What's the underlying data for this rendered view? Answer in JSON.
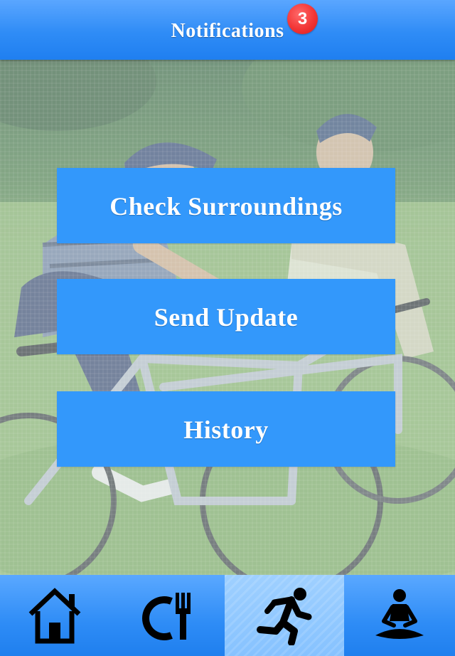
{
  "header": {
    "title": "Notifications",
    "badge_count": "3"
  },
  "menu": {
    "check_surroundings": "Check Surroundings",
    "send_update": "Send Update",
    "history": "History"
  },
  "tabbar": {
    "tabs": [
      {
        "icon": "home-icon",
        "active": false
      },
      {
        "icon": "restaurant-icon",
        "active": false
      },
      {
        "icon": "running-icon",
        "active": true
      },
      {
        "icon": "meditation-icon",
        "active": false
      }
    ]
  },
  "colors": {
    "header_blue": "#2f8cf6",
    "button_blue": "#3398fb",
    "active_tab": "#86c2ff",
    "badge_red": "#f23535"
  }
}
